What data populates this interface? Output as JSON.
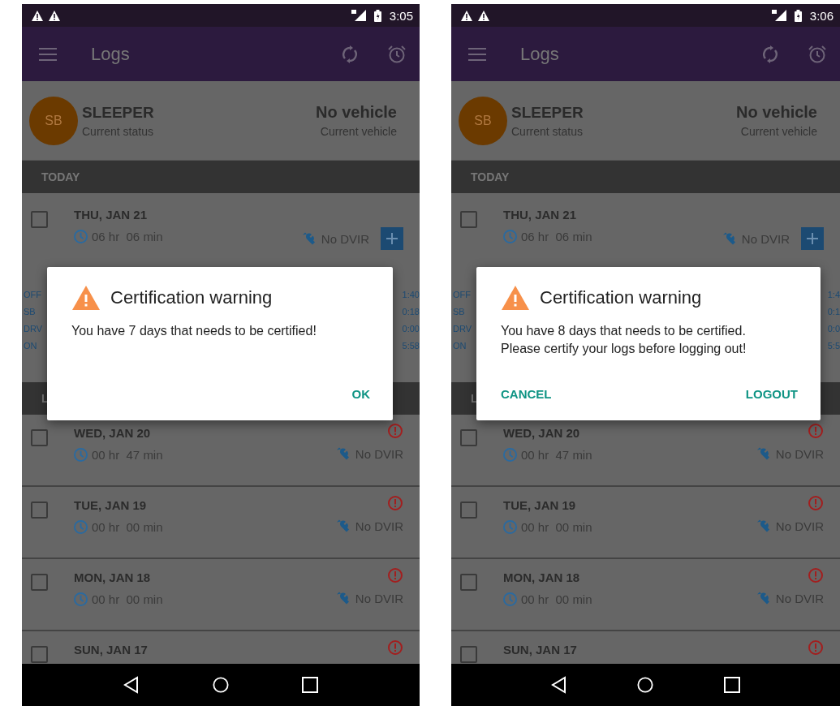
{
  "phones": [
    {
      "status_bar": {
        "time": "3:05"
      },
      "app_bar": {
        "title": "Logs"
      },
      "current": {
        "initials": "SB",
        "status": "SLEEPER",
        "status_label": "Current status",
        "vehicle": "No vehicle",
        "vehicle_label": "Current vehicle"
      },
      "sections": [
        {
          "title": "TODAY",
          "days": [
            {
              "kind": "today",
              "date": "THU, JAN 21",
              "duration": "06 hr  06 min",
              "dvir": "No DVIR",
              "checked": false,
              "grid": {
                "labels": [
                  "OFF",
                  "SB",
                  "DRV",
                  "ON"
                ],
                "values": [
                  "1:40",
                  "0:18",
                  "0:00",
                  "5:58"
                ]
              }
            }
          ]
        },
        {
          "title": "L",
          "days": [
            {
              "kind": "past",
              "date": "WED, JAN 20",
              "duration": "00 hr  47 min",
              "dvir": "No DVIR",
              "checked": false
            },
            {
              "kind": "past",
              "date": "TUE, JAN 19",
              "duration": "00 hr  00 min",
              "dvir": "No DVIR",
              "checked": false
            },
            {
              "kind": "past",
              "date": "MON, JAN 18",
              "duration": "00 hr  00 min",
              "dvir": "No DVIR",
              "checked": false
            },
            {
              "kind": "past",
              "date": "SUN, JAN 17",
              "checked": false
            }
          ]
        }
      ],
      "dialog": {
        "title": "Certification warning",
        "message": "You have 7 days that needs to be certified!",
        "buttons": [
          "OK"
        ]
      }
    },
    {
      "status_bar": {
        "time": "3:06"
      },
      "app_bar": {
        "title": "Logs"
      },
      "current": {
        "initials": "SB",
        "status": "SLEEPER",
        "status_label": "Current status",
        "vehicle": "No vehicle",
        "vehicle_label": "Current vehicle"
      },
      "sections": [
        {
          "title": "TODAY",
          "days": [
            {
              "kind": "today",
              "date": "THU, JAN 21",
              "duration": "06 hr  06 min",
              "dvir": "No DVIR",
              "checked": false,
              "grid": {
                "labels": [
                  "OFF",
                  "SB",
                  "DRV",
                  "ON"
                ],
                "values": [
                  "1:4",
                  "0:1",
                  "0:0",
                  "5:5"
                ]
              }
            }
          ]
        },
        {
          "title": "L",
          "days": [
            {
              "kind": "past",
              "date": "WED, JAN 20",
              "duration": "00 hr  47 min",
              "dvir": "No DVIR",
              "checked": false
            },
            {
              "kind": "past",
              "date": "TUE, JAN 19",
              "duration": "00 hr  00 min",
              "dvir": "No DVIR",
              "checked": false
            },
            {
              "kind": "past",
              "date": "MON, JAN 18",
              "duration": "00 hr  00 min",
              "dvir": "No DVIR",
              "checked": false
            },
            {
              "kind": "past",
              "date": "SUN, JAN 17",
              "checked": false
            }
          ]
        }
      ],
      "dialog": {
        "title": "Certification warning",
        "message": "You have 8 days that needs to be certified.\nPlease certify your logs before logging out!",
        "buttons": [
          "CANCEL",
          "LOGOUT"
        ]
      }
    }
  ]
}
